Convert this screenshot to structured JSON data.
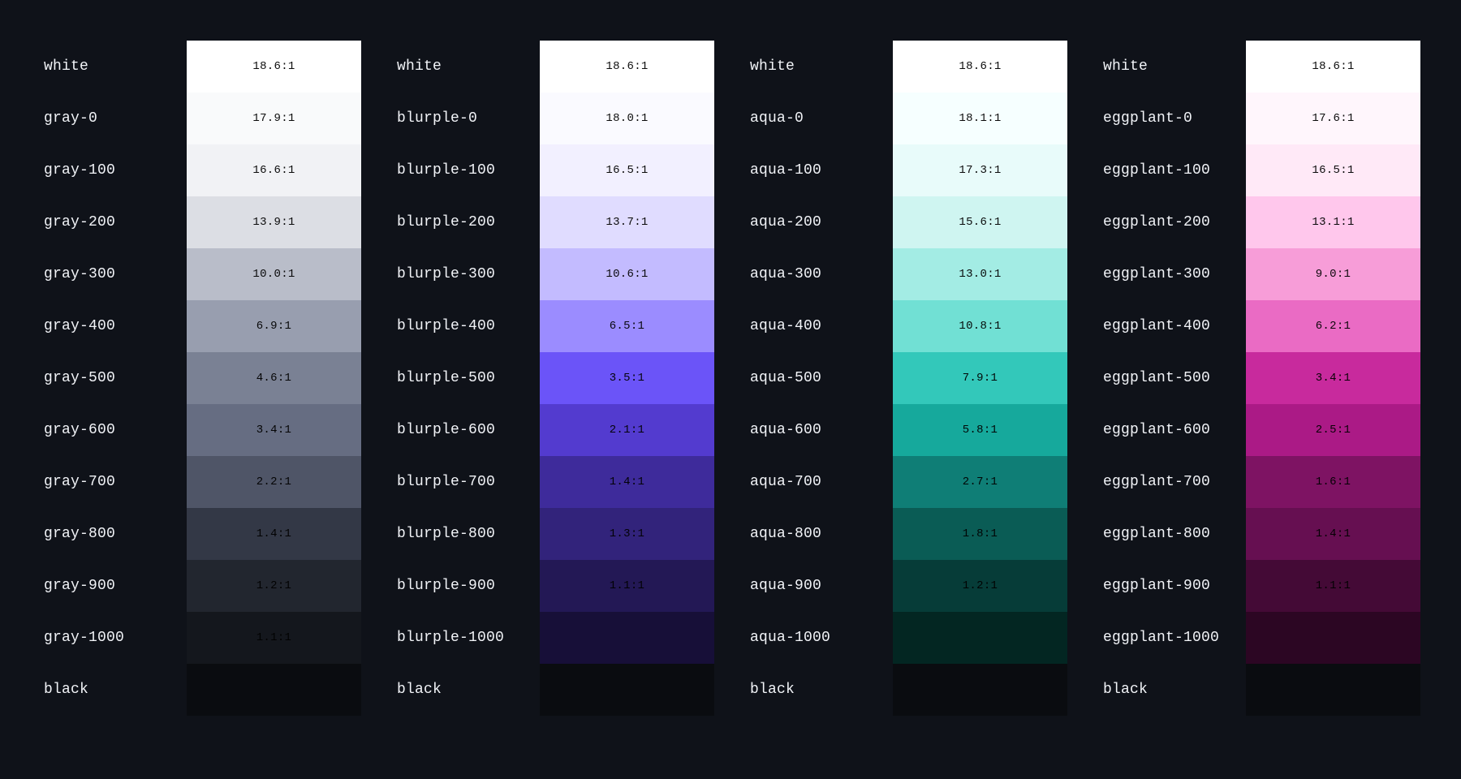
{
  "palettes": [
    {
      "name": "gray",
      "steps": [
        {
          "label": "white",
          "ratio": "18.6:1",
          "hex": "#ffffff"
        },
        {
          "label": "gray-0",
          "ratio": "17.9:1",
          "hex": "#f9fafb"
        },
        {
          "label": "gray-100",
          "ratio": "16.6:1",
          "hex": "#f1f2f5"
        },
        {
          "label": "gray-200",
          "ratio": "13.9:1",
          "hex": "#dcdee4"
        },
        {
          "label": "gray-300",
          "ratio": "10.0:1",
          "hex": "#b9bdc9"
        },
        {
          "label": "gray-400",
          "ratio": "6.9:1",
          "hex": "#989eaf"
        },
        {
          "label": "gray-500",
          "ratio": "4.6:1",
          "hex": "#7a8194"
        },
        {
          "label": "gray-600",
          "ratio": "3.4:1",
          "hex": "#666d82"
        },
        {
          "label": "gray-700",
          "ratio": "2.2:1",
          "hex": "#4f5567"
        },
        {
          "label": "gray-800",
          "ratio": "1.4:1",
          "hex": "#333846"
        },
        {
          "label": "gray-900",
          "ratio": "1.2:1",
          "hex": "#22262f"
        },
        {
          "label": "gray-1000",
          "ratio": "1.1:1",
          "hex": "#14171d"
        },
        {
          "label": "black",
          "ratio": "",
          "hex": "#0a0c10"
        }
      ]
    },
    {
      "name": "blurple",
      "steps": [
        {
          "label": "white",
          "ratio": "18.6:1",
          "hex": "#ffffff"
        },
        {
          "label": "blurple-0",
          "ratio": "18.0:1",
          "hex": "#fafaff"
        },
        {
          "label": "blurple-100",
          "ratio": "16.5:1",
          "hex": "#f2f0ff"
        },
        {
          "label": "blurple-200",
          "ratio": "13.7:1",
          "hex": "#e0dcff"
        },
        {
          "label": "blurple-300",
          "ratio": "10.6:1",
          "hex": "#c3bbff"
        },
        {
          "label": "blurple-400",
          "ratio": "6.5:1",
          "hex": "#9b8cff"
        },
        {
          "label": "blurple-500",
          "ratio": "3.5:1",
          "hex": "#6b54f8"
        },
        {
          "label": "blurple-600",
          "ratio": "2.1:1",
          "hex": "#533bcf"
        },
        {
          "label": "blurple-700",
          "ratio": "1.4:1",
          "hex": "#3e2b9b"
        },
        {
          "label": "blurple-800",
          "ratio": "1.3:1",
          "hex": "#32237b"
        },
        {
          "label": "blurple-900",
          "ratio": "1.1:1",
          "hex": "#231855"
        },
        {
          "label": "blurple-1000",
          "ratio": "",
          "hex": "#170f38"
        },
        {
          "label": "black",
          "ratio": "",
          "hex": "#0a0c10"
        }
      ]
    },
    {
      "name": "aqua",
      "steps": [
        {
          "label": "white",
          "ratio": "18.6:1",
          "hex": "#ffffff"
        },
        {
          "label": "aqua-0",
          "ratio": "18.1:1",
          "hex": "#f6ffff"
        },
        {
          "label": "aqua-100",
          "ratio": "17.3:1",
          "hex": "#e8fbfa"
        },
        {
          "label": "aqua-200",
          "ratio": "15.6:1",
          "hex": "#cff5f1"
        },
        {
          "label": "aqua-300",
          "ratio": "13.0:1",
          "hex": "#a3ece4"
        },
        {
          "label": "aqua-400",
          "ratio": "10.8:1",
          "hex": "#71e0d4"
        },
        {
          "label": "aqua-500",
          "ratio": "7.9:1",
          "hex": "#33c8ba"
        },
        {
          "label": "aqua-600",
          "ratio": "5.8:1",
          "hex": "#16a99c"
        },
        {
          "label": "aqua-700",
          "ratio": "2.7:1",
          "hex": "#0f7e76"
        },
        {
          "label": "aqua-800",
          "ratio": "1.8:1",
          "hex": "#0a5c55"
        },
        {
          "label": "aqua-900",
          "ratio": "1.2:1",
          "hex": "#063c38"
        },
        {
          "label": "aqua-1000",
          "ratio": "",
          "hex": "#032622"
        },
        {
          "label": "black",
          "ratio": "",
          "hex": "#0a0c10"
        }
      ]
    },
    {
      "name": "eggplant",
      "steps": [
        {
          "label": "white",
          "ratio": "18.6:1",
          "hex": "#ffffff"
        },
        {
          "label": "eggplant-0",
          "ratio": "17.6:1",
          "hex": "#fff6fc"
        },
        {
          "label": "eggplant-100",
          "ratio": "16.5:1",
          "hex": "#ffe9f7"
        },
        {
          "label": "eggplant-200",
          "ratio": "13.1:1",
          "hex": "#ffc7ec"
        },
        {
          "label": "eggplant-300",
          "ratio": "9.0:1",
          "hex": "#f79dd8"
        },
        {
          "label": "eggplant-400",
          "ratio": "6.2:1",
          "hex": "#ea6bc4"
        },
        {
          "label": "eggplant-500",
          "ratio": "3.4:1",
          "hex": "#c82a9d"
        },
        {
          "label": "eggplant-600",
          "ratio": "2.5:1",
          "hex": "#ab1a86"
        },
        {
          "label": "eggplant-700",
          "ratio": "1.6:1",
          "hex": "#7e1363"
        },
        {
          "label": "eggplant-800",
          "ratio": "1.4:1",
          "hex": "#660f51"
        },
        {
          "label": "eggplant-900",
          "ratio": "1.1:1",
          "hex": "#440a36"
        },
        {
          "label": "eggplant-1000",
          "ratio": "",
          "hex": "#2c0623"
        },
        {
          "label": "black",
          "ratio": "",
          "hex": "#0a0c10"
        }
      ]
    }
  ]
}
